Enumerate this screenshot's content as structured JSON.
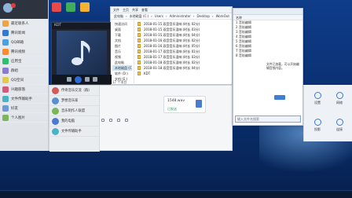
{
  "desktop": {
    "background": "#0a2f70"
  },
  "qq": {
    "contacts": [
      {
        "label": "最近联系人",
        "color": "#f0a24a"
      },
      {
        "label": "腾讯新闻",
        "color": "#2f7ad6"
      },
      {
        "label": "QQ邮箱",
        "color": "#4aa0e6"
      },
      {
        "label": "腾讯视频",
        "color": "#ff8a2a"
      },
      {
        "label": "应用宝",
        "color": "#2fbf71"
      },
      {
        "label": "群组",
        "color": "#8a7ad6"
      },
      {
        "label": "QQ空间",
        "color": "#e6c84a"
      },
      {
        "label": "兴趣部落",
        "color": "#d65a7a"
      },
      {
        "label": "文件传输助手",
        "color": "#49b3c5"
      },
      {
        "label": "好友",
        "color": "#6b9ad6"
      },
      {
        "label": "个人图片",
        "color": "#7ab65a"
      }
    ]
  },
  "player": {
    "title": "KDT"
  },
  "chat": {
    "contacts": [
      {
        "label": "传奇音乐交流（群）",
        "color": "#d25a5a"
      },
      {
        "label": "梦想音乐家",
        "color": "#5a8ed2"
      },
      {
        "label": "音乐制作人联盟",
        "color": "#7ab65a"
      },
      {
        "label": "我的电脑",
        "color": "#4a7bd0"
      },
      {
        "label": "文件传输助手",
        "color": "#49b3c5"
      }
    ],
    "file": {
      "name": "1548.wav",
      "status": "已发送"
    }
  },
  "explorer": {
    "tabs": [
      "文件",
      "主页",
      "共享",
      "查看"
    ],
    "breadcrumbs": [
      "此电脑",
      "本地磁盘 (C:)",
      "Users",
      "Administrator",
      "Desktop",
      "WorkOut"
    ],
    "nav": [
      "快速访问",
      "桌面",
      "下载",
      "文档",
      "图片",
      "音乐",
      "视频",
      "此电脑",
      "本地磁盘 (C:)",
      "软件 (D:)",
      "文档 (E:)",
      "娱乐 (F:)",
      "网络"
    ],
    "files": [
      "2018-01-15 双音音乐混响 (时长 02分)",
      "2018-01-15 双音音乐混响 (时长 03分)",
      "2018-01-15 双音音乐混响 (时长 04分)",
      "2018-01-16 双音音乐混响 (时长 02分)",
      "2018-01-16 双音音乐混响 (时长 05分)",
      "2018-01-17 双音音乐混响 (时长 01分)",
      "2018-01-17 双音音乐混响 (时长 03分)",
      "2018-01-18 双音音乐混响 (时长 02分)",
      "2018-01-18 双音音乐混响 (时长 04分)",
      "KDT"
    ],
    "status": "17 个项目"
  },
  "dialog": {
    "title": "",
    "header": "名称",
    "rows": [
      "1  音轨编辑",
      "2  音轨编辑",
      "3  音轨编辑",
      "4  音轨编辑",
      "5  音轨编辑",
      "6  音轨编辑",
      "7  音轨编辑",
      "8  音轨编辑"
    ],
    "note": "文件已加载，可以开始编辑音频内容。",
    "input_placeholder": "输入文件名搜索"
  },
  "quick": {
    "tiles": [
      {
        "label": "设置"
      },
      {
        "label": "网络"
      },
      {
        "label": "投影"
      },
      {
        "label": "连接"
      }
    ]
  }
}
